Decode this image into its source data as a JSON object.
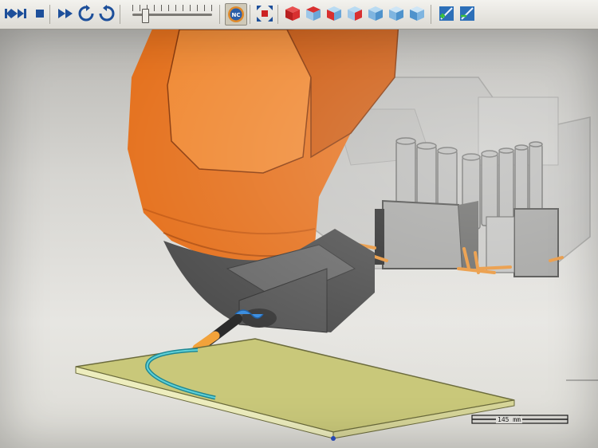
{
  "toolbar": {
    "buttons": [
      {
        "id": "step-back",
        "icon": "step-back-icon"
      },
      {
        "id": "skip-to-end",
        "icon": "skip-forward-icon"
      },
      {
        "id": "stop",
        "icon": "stop-icon"
      },
      {
        "id": "fast-forward",
        "icon": "fast-forward-icon"
      },
      {
        "id": "refresh",
        "icon": "refresh-icon"
      },
      {
        "id": "rewind-refresh",
        "icon": "reverse-refresh-icon"
      },
      {
        "id": "nc",
        "icon": "nc-icon",
        "label": "NC"
      },
      {
        "id": "fit-view",
        "icon": "fit-view-icon"
      },
      {
        "id": "view-cube-1",
        "icon": "cube-view-icon"
      },
      {
        "id": "view-cube-2",
        "icon": "cube-view-icon"
      },
      {
        "id": "view-cube-3",
        "icon": "cube-view-icon"
      },
      {
        "id": "view-cube-4",
        "icon": "cube-view-icon"
      },
      {
        "id": "view-cube-5",
        "icon": "cube-view-icon"
      },
      {
        "id": "view-cube-6",
        "icon": "cube-view-icon"
      },
      {
        "id": "view-cube-7",
        "icon": "cube-view-icon"
      },
      {
        "id": "add-tool",
        "icon": "add-toolpath-icon"
      },
      {
        "id": "remove-tool",
        "icon": "remove-toolpath-icon"
      }
    ],
    "speed_slider": {
      "value_fraction": 0.16
    }
  },
  "viewport": {
    "scale_label": "145 mm"
  },
  "colors": {
    "robot_orange": "#e5721f",
    "workpiece": "#c9c87a",
    "toolpath": "#2ea8b4",
    "nozzle_accent": "#f2a23a",
    "machine_gray": "#5a5a5a"
  }
}
